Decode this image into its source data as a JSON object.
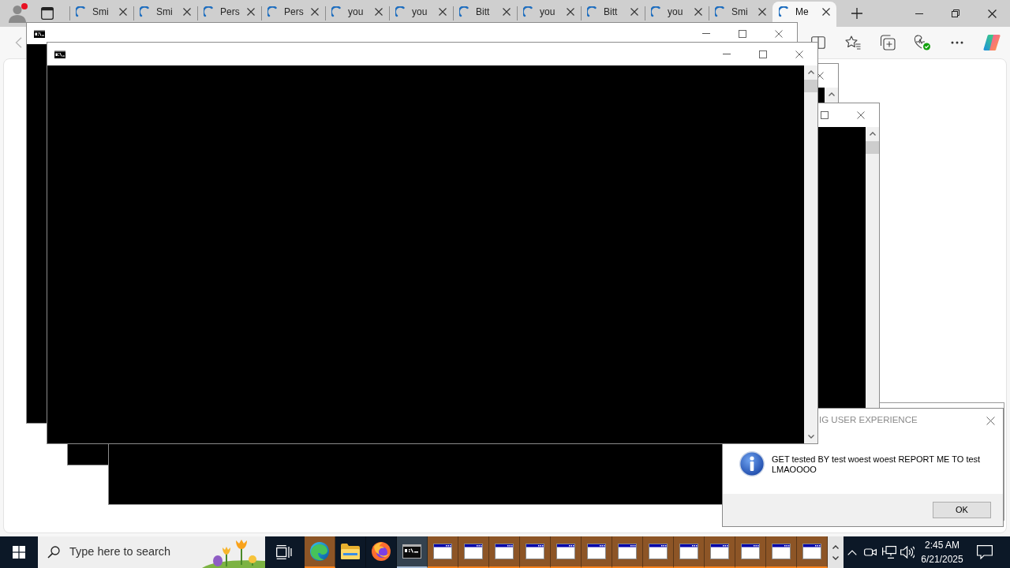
{
  "browser": {
    "profile": {
      "notification": true
    },
    "tabs": [
      {
        "label": "Smi",
        "selected": false
      },
      {
        "label": "Smi",
        "selected": false
      },
      {
        "label": "Pers",
        "selected": false
      },
      {
        "label": "Pers",
        "selected": false
      },
      {
        "label": "you",
        "selected": false
      },
      {
        "label": "you",
        "selected": false
      },
      {
        "label": "Bitt",
        "selected": false
      },
      {
        "label": "you",
        "selected": false
      },
      {
        "label": "Bitt",
        "selected": false
      },
      {
        "label": "you",
        "selected": false
      },
      {
        "label": "Smi",
        "selected": false
      },
      {
        "label": "Me",
        "selected": true
      }
    ]
  },
  "message_box": {
    "title": "IG USER EXPERIENCE",
    "message": "GET tested BY test woest woest REPORT ME TO test LMAOOOO",
    "buttons": [
      "OK"
    ]
  },
  "taskbar": {
    "search": {
      "placeholder": "Type here to search"
    },
    "apps": [
      {
        "kind": "edge",
        "flashing": true,
        "active": false
      },
      {
        "kind": "explorer",
        "flashing": false,
        "active": false
      },
      {
        "kind": "firefox",
        "flashing": false,
        "active": false
      },
      {
        "kind": "console",
        "flashing": false,
        "active": true
      },
      {
        "kind": "window",
        "flashing": true,
        "active": false
      },
      {
        "kind": "window",
        "flashing": true,
        "active": false
      },
      {
        "kind": "window",
        "flashing": true,
        "active": false
      },
      {
        "kind": "window",
        "flashing": true,
        "active": false
      },
      {
        "kind": "window",
        "flashing": true,
        "active": false
      },
      {
        "kind": "window",
        "flashing": true,
        "active": false
      },
      {
        "kind": "window",
        "flashing": true,
        "active": false
      },
      {
        "kind": "window",
        "flashing": true,
        "active": false
      },
      {
        "kind": "window",
        "flashing": true,
        "active": false
      },
      {
        "kind": "window",
        "flashing": true,
        "active": false
      },
      {
        "kind": "window",
        "flashing": true,
        "active": false
      },
      {
        "kind": "window",
        "flashing": true,
        "active": false
      },
      {
        "kind": "window",
        "flashing": true,
        "active": false
      }
    ],
    "clock": {
      "time": "2:45 AM",
      "date": "6/21/2025"
    }
  }
}
